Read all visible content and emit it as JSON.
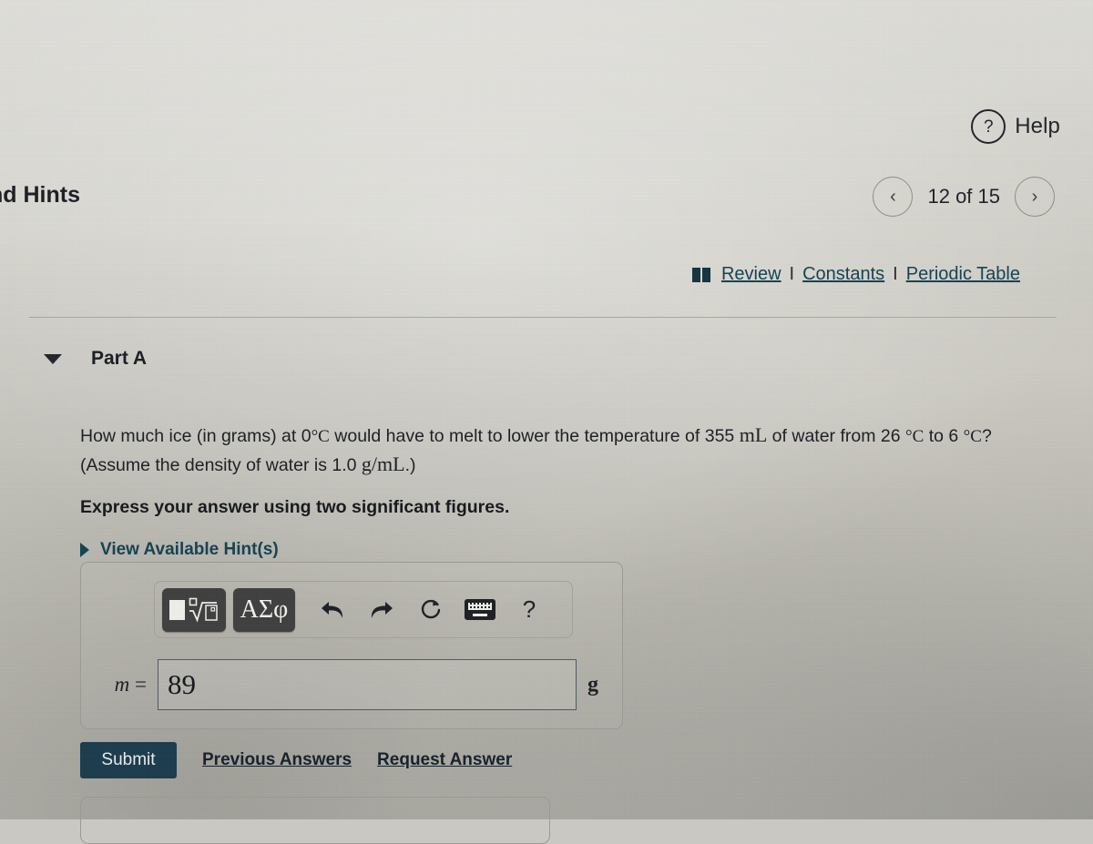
{
  "header": {
    "help_label": "Help",
    "help_icon": "question-circle-icon",
    "page_title": "nd Hints",
    "pager": {
      "prev_icon": "chevron-left-icon",
      "next_icon": "chevron-right-icon",
      "count_label": "12 of 15"
    }
  },
  "resource_links": {
    "book_icon": "open-book-icon",
    "review": "Review",
    "separator": "I",
    "constants": "Constants",
    "periodic_table": "Periodic Table",
    "link_color": "#144250"
  },
  "part": {
    "toggle_icon": "triangle-down-icon",
    "label": "Part A"
  },
  "question": {
    "line1_a": "How much ice (in grams) at 0",
    "deg_c_1": "°C",
    "line1_b": " would have to melt to lower the temperature of 355 ",
    "ml": "mL",
    "line1_c": " of water from 26 ",
    "deg_c_2": "°C",
    "line1_d": " to 6 ",
    "deg_c_3": "°C",
    "line1_e": "?",
    "line2_a": "(Assume the density of water is 1.0 ",
    "gml": "g/mL",
    "line2_b": ".)",
    "instruction": "Express your answer using two significant figures.",
    "hints_toggle_icon": "triangle-right-icon",
    "hints_label": "View Available Hint(s)"
  },
  "answer": {
    "toolbar": {
      "template_button": "math-template-button",
      "greek_button_label": "ΑΣφ",
      "undo_icon": "undo-arrow-icon",
      "redo_icon": "redo-arrow-icon",
      "reset_icon": "reset-circle-icon",
      "keyboard_icon": "keyboard-icon",
      "help_icon_label": "?"
    },
    "variable_label": "m",
    "equals": " =",
    "value": "89",
    "unit": "g"
  },
  "actions": {
    "submit_label": "Submit",
    "submit_color": "#1b3c4e",
    "previous_answers_label": "Previous Answers",
    "request_answer_label": "Request Answer"
  }
}
